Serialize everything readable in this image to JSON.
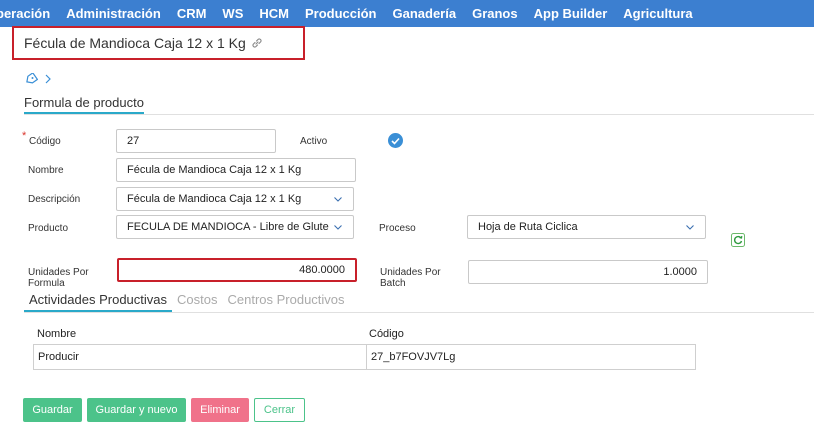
{
  "nav": {
    "items": [
      "peración",
      "Administración",
      "CRM",
      "WS",
      "HCM",
      "Producción",
      "Ganadería",
      "Granos",
      "App Builder",
      "Agricultura"
    ]
  },
  "header": {
    "title": "Fécula de Mandioca Caja 12 x 1 Kg"
  },
  "section": {
    "tab_label": "Formula de producto"
  },
  "form": {
    "codigo_label": "Código",
    "codigo_required_mark": "*",
    "codigo_value": "27",
    "activo_label": "Activo",
    "activo_checked": true,
    "nombre_label": "Nombre",
    "nombre_value": "Fécula de Mandioca Caja 12 x 1 Kg",
    "descripcion_label": "Descripción",
    "descripcion_value": "Fécula de Mandioca Caja 12 x 1 Kg",
    "producto_label": "Producto",
    "producto_value": "FECULA DE MANDIOCA - Libre de Gluten (C",
    "proceso_label": "Proceso",
    "proceso_value": "Hoja de Ruta Ciclica",
    "unidades_formula_label_1": "Unidades Por",
    "unidades_formula_label_2": "Formula",
    "unidades_formula_value": "480.0000",
    "unidades_batch_label_1": "Unidades Por",
    "unidades_batch_label_2": "Batch",
    "unidades_batch_value": "1.0000"
  },
  "subtabs": {
    "items": [
      "Actividades Productivas",
      "Costos",
      "Centros Productivos"
    ],
    "active_index": 0
  },
  "table": {
    "headers": [
      "Nombre",
      "Código"
    ],
    "rows": [
      [
        "Producir",
        "27_b7FOVJV7Lg"
      ]
    ]
  },
  "buttons": {
    "save": "Guardar",
    "save_new": "Guardar y nuevo",
    "delete": "Eliminar",
    "close": "Cerrar"
  },
  "colors": {
    "nav_bg": "#3c7fd0",
    "accent": "#2aa9c9",
    "highlight_border": "#c8202a",
    "save_green": "#4cc38a",
    "delete_pink": "#f0728a"
  }
}
